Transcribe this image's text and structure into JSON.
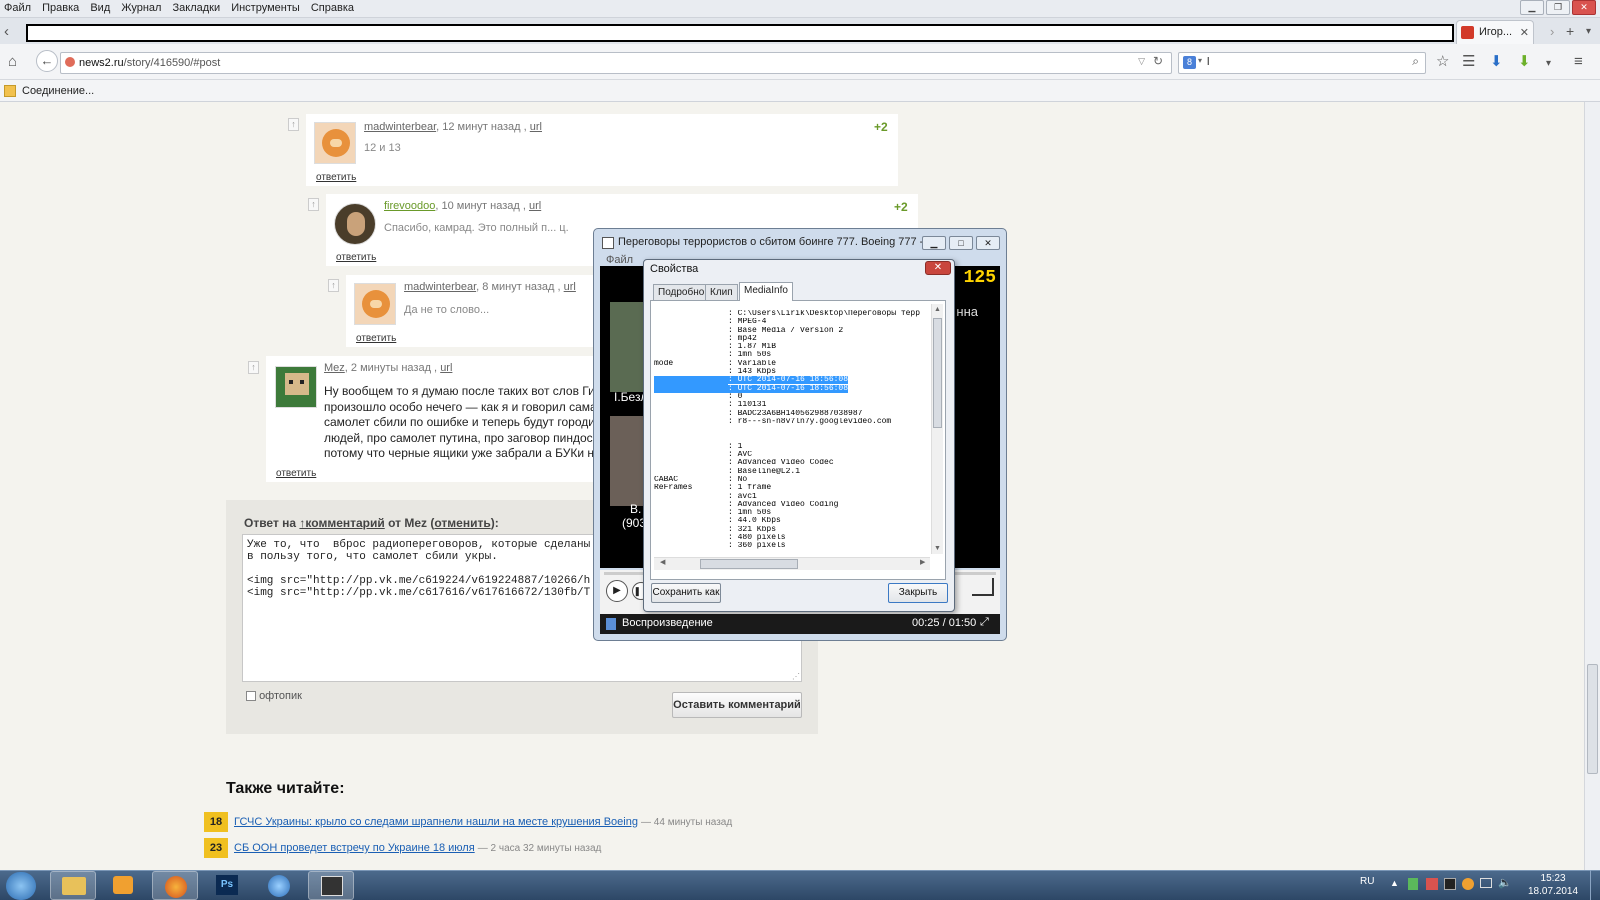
{
  "browser": {
    "menu": [
      "Файл",
      "Правка",
      "Вид",
      "Журнал",
      "Закладки",
      "Инструменты",
      "Справка"
    ],
    "tab_title": "Игор...",
    "url_domain": "news2.ru",
    "url_path": "/story/416590/#post",
    "search_value": "l",
    "bookmark": "Соединение..."
  },
  "comments": [
    {
      "user": "madwinterbear",
      "time": ", 12 минут назад ,",
      "url": "url",
      "score": "+2",
      "text": "12 и 13",
      "reply": "ответить"
    },
    {
      "user": "firevoodoo",
      "time": ", 10 минут назад ,",
      "url": "url",
      "score": "+2",
      "text": "Спасибо, камрад. Это полный п... ц.",
      "reply": "ответить"
    },
    {
      "user": "madwinterbear",
      "time": ", 8 минут назад ,",
      "url": "url",
      "text": "Да не то слово...",
      "reply": "ответить"
    },
    {
      "user": "Mez",
      "time": ", 2 минуты назад ,",
      "url": "url",
      "reply": "ответить",
      "lines": [
        "Ну вообщем то я думаю после таких вот слов Гир",
        "произошло особо нечего — как я и говорил самая",
        "самолет сбили по ошибке и теперь будут городи",
        "людей, про самолет путина, про заговор пиндосс",
        "потому что черные ящики уже забрали а БУКи на"
      ]
    }
  ],
  "reply_form": {
    "prefix": "Ответ на ",
    "link": "↑комментарий",
    "mid": " от ",
    "user": "Mez",
    "cancel_open": " (",
    "cancel": "отменить",
    "cancel_close": "):",
    "text": "Уже то, что  вброс радиопереговоров, которые сделаны\nв пользу того, что самолет сбили укры.\n\n<img src=\"http://pp.vk.me/c619224/v619224887/10266/h\n<img src=\"http://pp.vk.me/c617616/v617616672/130fb/T",
    "offtopic": "офтопик",
    "submit": "Оставить комментарий"
  },
  "also_read": {
    "title": "Также читайте:",
    "items": [
      {
        "num": "18",
        "title": "ГСЧС Украины: крыло со следами шрапнели нашли на месте крушения Boeing",
        "time": "— 44 минуты назад"
      },
      {
        "num": "23",
        "title": "СБ ООН проведет встречу по Украине 18 июля",
        "time": "— 2 часа 32 минуты назад"
      }
    ]
  },
  "player": {
    "title": "Переговоры террористов о сбитом боинге 777. Boeing 777 - M...",
    "menu_file": "Файл",
    "status": "Воспроизведение",
    "time": "00:25 / 01:50",
    "overlay_numbers": "125",
    "overlay_text_right": "нна",
    "overlay_text_1": "I.Безл",
    "overlay_text_2": "В.",
    "overlay_text_3": "(903"
  },
  "dialog": {
    "title": "Свойства",
    "tabs": [
      "Подробно",
      "Клип",
      "MediaInfo"
    ],
    "active_tab": "MediaInfo",
    "lines": [
      {
        "k": "",
        "v": ": C:\\Users\\Lirik\\Desktop\\Переговоры терр"
      },
      {
        "k": "",
        "v": ": MPEG-4"
      },
      {
        "k": "",
        "v": ": Base Media / Version 2"
      },
      {
        "k": "",
        "v": ": mp42"
      },
      {
        "k": "",
        "v": ": 1.87 MiB"
      },
      {
        "k": "",
        "v": ": 1mn 50s"
      },
      {
        "k": "mode",
        "v": ": Variable"
      },
      {
        "k": "",
        "v": ": 143 Kbps"
      },
      {
        "k": "",
        "v": ": UTC 2014-07-16 18:56:08",
        "sel": true
      },
      {
        "k": "",
        "v": ": UTC 2014-07-16 18:56:08",
        "sel": true
      },
      {
        "k": "",
        "v": ": 0"
      },
      {
        "k": "",
        "v": ": 110131"
      },
      {
        "k": "",
        "v": ": BADC23A6BH1405629887038987"
      },
      {
        "k": "",
        "v": ": r8---sn-n8v7ln7y.googlevideo.com"
      },
      {
        "k": "",
        "v": ""
      },
      {
        "k": "",
        "v": ""
      },
      {
        "k": "",
        "v": ": 1"
      },
      {
        "k": "",
        "v": ": AVC"
      },
      {
        "k": "",
        "v": ": Advanced Video Codec"
      },
      {
        "k": "",
        "v": ": Baseline@L2.1"
      },
      {
        "k": "CABAC",
        "v": ": No"
      },
      {
        "k": "ReFrames",
        "v": ": 1 frame"
      },
      {
        "k": "",
        "v": ": avc1"
      },
      {
        "k": "",
        "v": ": Advanced Video Coding"
      },
      {
        "k": "",
        "v": ": 1mn 50s"
      },
      {
        "k": "",
        "v": ": 44.0 Kbps"
      },
      {
        "k": "",
        "v": ": 321 Kbps"
      },
      {
        "k": "",
        "v": ": 480 pixels"
      },
      {
        "k": "",
        "v": ": 360 pixels"
      }
    ],
    "save_as": "Сохранить как",
    "close": "Закрыть"
  },
  "taskbar": {
    "lang": "RU",
    "time": "15:23",
    "date": "18.07.2014"
  },
  "colors": {
    "accent": "#3399ff",
    "score": "#6a9a2a",
    "also_read_badge": "#f0c020",
    "link": "#1a5fb4"
  }
}
